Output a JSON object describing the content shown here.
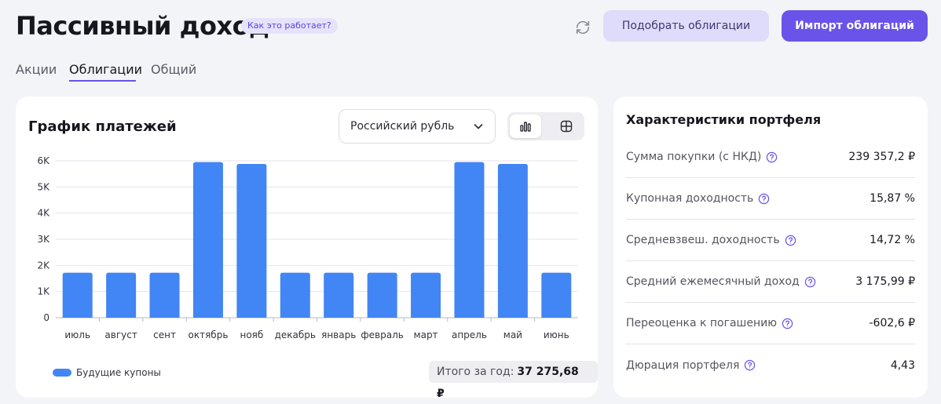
{
  "header": {
    "title": "Пассивный доход",
    "how_badge": "Как это работает?",
    "pick_button": "Подобрать облигации",
    "import_button": "Импорт облигаций"
  },
  "tabs": [
    {
      "label": "Акции"
    },
    {
      "label": "Облигации",
      "active": true
    },
    {
      "label": "Общий"
    }
  ],
  "chart_panel": {
    "title": "График платежей",
    "currency": "Российский рубль",
    "legend_label": "Будущие купоны",
    "total_label": "Итого за год:",
    "total_value": "37 275,68 ₽"
  },
  "chart_data": {
    "type": "bar",
    "categories": [
      "июль",
      "август",
      "сент",
      "октябрь",
      "нояб",
      "декабрь",
      "январь",
      "февраль",
      "март",
      "апрель",
      "май",
      "июнь"
    ],
    "series": [
      {
        "name": "Будущие купоны",
        "color": "#4285f4",
        "values": [
          1720,
          1720,
          1720,
          5950,
          5880,
          1720,
          1720,
          1720,
          1720,
          5950,
          5880,
          1720
        ]
      }
    ],
    "yticks": [
      "0",
      "1K",
      "2K",
      "3K",
      "4K",
      "5K",
      "6K"
    ],
    "ylim": [
      0,
      6000
    ],
    "grid": true,
    "legend": "bottom-left"
  },
  "stats_panel": {
    "title": "Характеристики портфеля",
    "rows": [
      {
        "label": "Сумма покупки (с НКД)",
        "value": "239 357,2 ₽"
      },
      {
        "label": "Купонная доходность",
        "value": "15,87 %"
      },
      {
        "label": "Средневзвеш. доходность",
        "value": "14,72 %"
      },
      {
        "label": "Средний ежемесячный доход",
        "value": "3 175,99 ₽"
      },
      {
        "label": "Переоценка к погашению",
        "value": "-602,6 ₽"
      },
      {
        "label": "Дюрация портфеля",
        "value": "4,43"
      }
    ]
  },
  "colors": {
    "accent": "#6a53e8",
    "bar": "#4285f4",
    "background": "#f3f4f7"
  }
}
